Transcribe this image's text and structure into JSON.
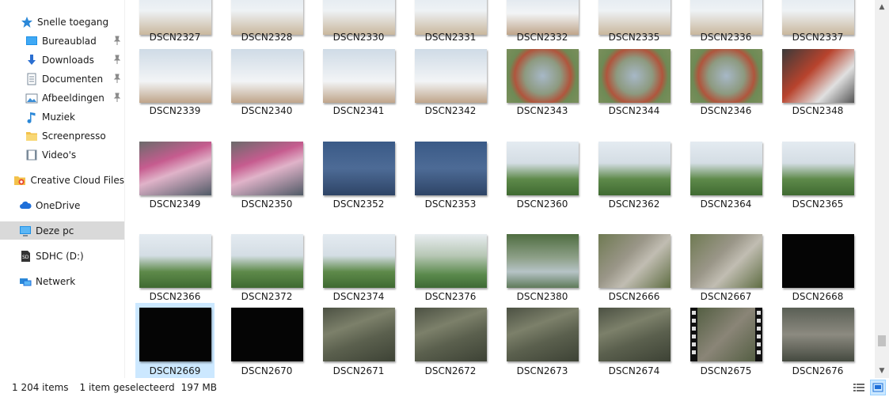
{
  "nav": {
    "quick_access": "Snelle toegang",
    "items": [
      {
        "label": "Bureaublad",
        "icon": "desktop-icon",
        "pinned": true
      },
      {
        "label": "Downloads",
        "icon": "download-icon",
        "pinned": true
      },
      {
        "label": "Documenten",
        "icon": "document-icon",
        "pinned": true
      },
      {
        "label": "Afbeeldingen",
        "icon": "pictures-icon",
        "pinned": true
      },
      {
        "label": "Muziek",
        "icon": "music-icon",
        "pinned": false
      },
      {
        "label": "Screenpresso",
        "icon": "folder-icon",
        "pinned": false
      },
      {
        "label": "Video's",
        "icon": "video-icon",
        "pinned": false
      }
    ],
    "creative_cloud": "Creative Cloud Files",
    "onedrive": "OneDrive",
    "this_pc": "Deze pc",
    "sdhc": "SDHC (D:)",
    "network": "Netwerk"
  },
  "files": [
    [
      "DSCN2327",
      "DSCN2328",
      "DSCN2330",
      "DSCN2331",
      "DSCN2332",
      "DSCN2335",
      "DSCN2336",
      "DSCN2337"
    ],
    [
      "DSCN2339",
      "DSCN2340",
      "DSCN2341",
      "DSCN2342",
      "DSCN2343",
      "DSCN2344",
      "DSCN2346",
      "DSCN2348"
    ],
    [
      "DSCN2349",
      "DSCN2350",
      "DSCN2352",
      "DSCN2353",
      "DSCN2360",
      "DSCN2362",
      "DSCN2364",
      "DSCN2365"
    ],
    [
      "DSCN2366",
      "DSCN2372",
      "DSCN2374",
      "DSCN2376",
      "DSCN2380",
      "DSCN2666",
      "DSCN2667",
      "DSCN2668"
    ],
    [
      "DSCN2669",
      "DSCN2670",
      "DSCN2671",
      "DSCN2672",
      "DSCN2673",
      "DSCN2674",
      "DSCN2675",
      "DSCN2676"
    ]
  ],
  "selected_file": "DSCN2669",
  "status": {
    "item_count": "1 204 items",
    "selection": "1 item geselecteerd",
    "size": "197 MB"
  },
  "colors": {
    "selection": "#cce8ff",
    "nav_selected": "#d9d9d9",
    "accent": "#0078d7"
  }
}
